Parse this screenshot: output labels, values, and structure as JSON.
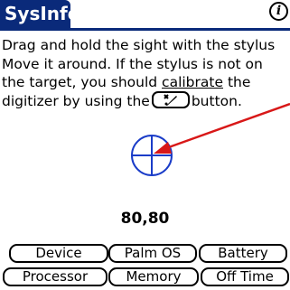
{
  "app": {
    "title": "SysInfo",
    "title_color": "#0a2a7a",
    "info_glyph": "i",
    "info_icon": "info-icon"
  },
  "instructions": {
    "line1": "Drag and hold the sight with the stylus",
    "line2": "Move it around.  If the stylus is not on",
    "line3_a": "the target, you should ",
    "line3_b": "calibrate",
    "line3_c": " the",
    "line4_a": "digitizer by using the",
    "line4_b": "button."
  },
  "calibrate_button": {
    "icon": "stylus-calibrate-icon"
  },
  "target": {
    "color": "#1a3cc8",
    "icon": "crosshair-target-icon"
  },
  "annotation": {
    "color": "#d81818",
    "icon": "red-arrow"
  },
  "coordinates": {
    "value": "80,80"
  },
  "buttons": {
    "device": "Device",
    "palm_os": "Palm OS",
    "battery": "Battery",
    "processor": "Processor",
    "memory": "Memory",
    "off_time": "Off Time"
  }
}
